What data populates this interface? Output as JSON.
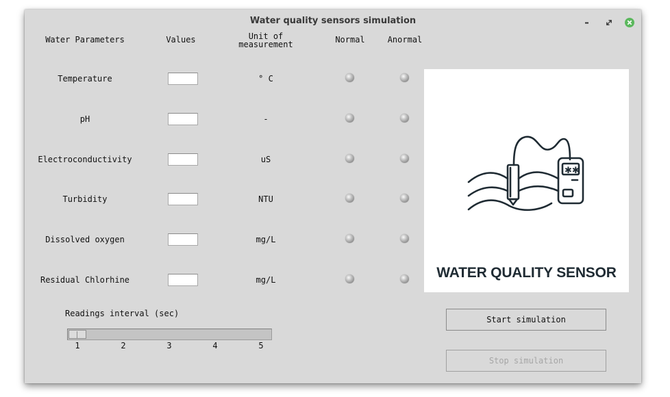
{
  "window": {
    "title": "Water quality sensors simulation"
  },
  "headers": {
    "parameters": "Water Parameters",
    "values": "Values",
    "unit_line1": "Unit of",
    "unit_line2": "measurement",
    "normal": "Normal",
    "abnormal": "Anormal"
  },
  "rows": [
    {
      "name": "Temperature",
      "value": "",
      "unit": "° C"
    },
    {
      "name": "pH",
      "value": "",
      "unit": "-"
    },
    {
      "name": "Electroconductivity",
      "value": "",
      "unit": "uS"
    },
    {
      "name": "Turbidity",
      "value": "",
      "unit": "NTU"
    },
    {
      "name": "Dissolved oxygen",
      "value": "",
      "unit": "mg/L"
    },
    {
      "name": "Residual Chlorhine",
      "value": "",
      "unit": "mg/L"
    }
  ],
  "image": {
    "caption": "WATER QUALITY SENSOR",
    "icon": "water-quality-sensor-icon"
  },
  "slider": {
    "label": "Readings interval (sec)",
    "value": 1,
    "min": 1,
    "max": 5,
    "ticks": [
      "1",
      "2",
      "3",
      "4",
      "5"
    ]
  },
  "buttons": {
    "start": "Start simulation",
    "stop": "Stop simulation"
  },
  "colors": {
    "window_bg": "#d9d9d9",
    "close_icon": "#5bb85d",
    "disabled_text": "#a6a6a6"
  }
}
